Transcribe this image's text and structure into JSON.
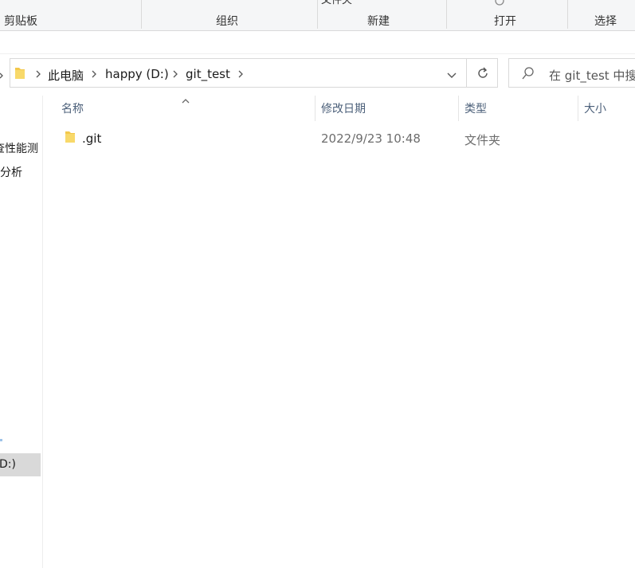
{
  "ribbon": {
    "groups": [
      {
        "label": "剪贴板"
      },
      {
        "label": "组织"
      },
      {
        "label": "新建"
      },
      {
        "label": "打开"
      },
      {
        "label": "选择"
      }
    ],
    "partial_top_text": "文件夹"
  },
  "address_bar": {
    "breadcrumbs": [
      "此电脑",
      "happy (D:)",
      "git_test"
    ]
  },
  "search": {
    "placeholder": "在 git_test 中搜"
  },
  "nav_pane": {
    "items": [
      {
        "label": "查性能测"
      },
      {
        "label": "分析"
      },
      {
        "label": "D:)"
      }
    ]
  },
  "file_list": {
    "columns": [
      "名称",
      "修改日期",
      "类型",
      "大小"
    ],
    "rows": [
      {
        "name": ".git",
        "modified": "2022/9/23 10:48",
        "type": "文件夹",
        "size": ""
      }
    ]
  },
  "colors": {
    "folder": "#f3c84b",
    "selection": "#d9d9d9",
    "header_text": "#4c607a"
  }
}
